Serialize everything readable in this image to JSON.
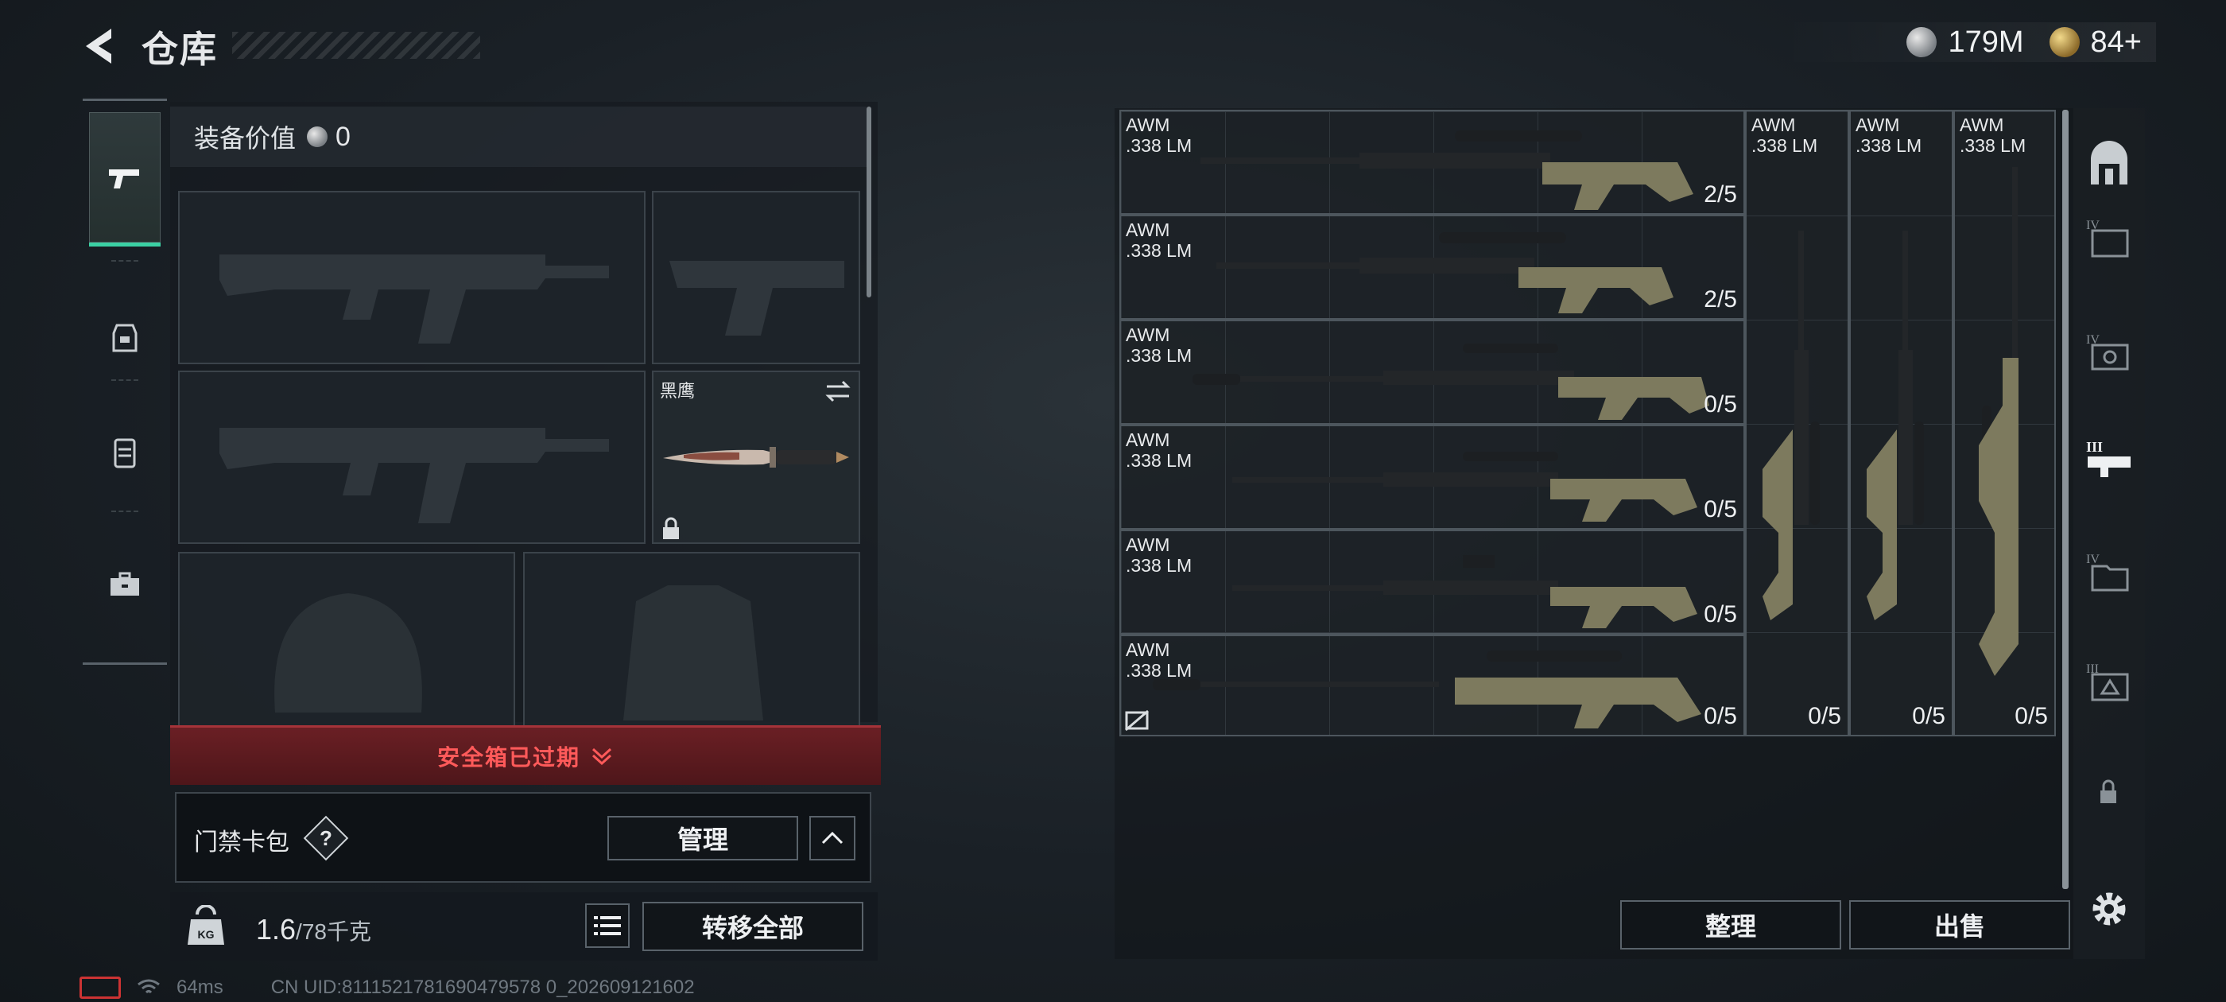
{
  "header": {
    "title": "仓库",
    "currency": [
      {
        "type": "silver-coin-icon",
        "value": "179M"
      },
      {
        "type": "gold-coin-icon",
        "value": "84+"
      }
    ]
  },
  "left_tabs": [
    {
      "name": "weapons",
      "icon": "pistol-icon",
      "active": true
    },
    {
      "name": "backpack",
      "icon": "backpack-icon",
      "active": false
    },
    {
      "name": "vest",
      "icon": "chest-rig-icon",
      "active": false
    },
    {
      "name": "toolbox",
      "icon": "toolbox-icon",
      "active": false
    }
  ],
  "equipment": {
    "value_label": "装备价值",
    "value": "0",
    "slots": [
      {
        "name": "primary-weapon",
        "icon": "rifle-silhouette-icon"
      },
      {
        "name": "sidearm",
        "icon": "pistol-silhouette-icon"
      },
      {
        "name": "secondary-weapon",
        "icon": "rifle-silhouette-icon"
      },
      {
        "name": "melee",
        "label": "黑鹰",
        "icon": "knife-icon",
        "locked": true
      },
      {
        "name": "helmet",
        "icon": "helmet-silhouette-icon"
      },
      {
        "name": "armor",
        "icon": "armor-silhouette-icon"
      }
    ]
  },
  "safe_box": {
    "status_text": "安全箱已过期"
  },
  "keycard": {
    "label": "门禁卡包",
    "help": "?",
    "manage_label": "管理"
  },
  "weight": {
    "icon_text": "KG",
    "current": "1.6",
    "max": "/78千克"
  },
  "actions": {
    "transfer_all": "转移全部",
    "sort": "整理",
    "sell": "出售"
  },
  "storage": {
    "items": [
      {
        "name": "AWM",
        "caliber": ".338 LM",
        "count": "2/5"
      },
      {
        "name": "AWM",
        "caliber": ".338 LM",
        "count": "2/5"
      },
      {
        "name": "AWM",
        "caliber": ".338 LM",
        "count": "0/5"
      },
      {
        "name": "AWM",
        "caliber": ".338 LM",
        "count": "0/5"
      },
      {
        "name": "AWM",
        "caliber": ".338 LM",
        "count": "0/5"
      },
      {
        "name": "AWM",
        "caliber": ".338 LM",
        "count": "0/5"
      },
      {
        "name": "AWM",
        "caliber": ".338 LM",
        "count": "0/5"
      },
      {
        "name": "AWM",
        "caliber": ".338 LM",
        "count": "0/5"
      },
      {
        "name": "AWM",
        "caliber": ".338 LM",
        "count": "0/5"
      }
    ]
  },
  "right_tabs": [
    "door-icon",
    "storage-IV-icon",
    "storage-IV-gear-icon",
    "storage-III-weapon-icon",
    "storage-IV-folder-icon",
    "storage-III-box-icon",
    "lock-icon",
    "settings-icon"
  ],
  "footer": {
    "ping": "64ms",
    "uid": "CN UID:8111521781690479578 0_202609121602"
  },
  "colors": {
    "accent": "#3bd1a4",
    "alert": "#ff5a5a",
    "alert_bg": "#5a1b1f"
  }
}
